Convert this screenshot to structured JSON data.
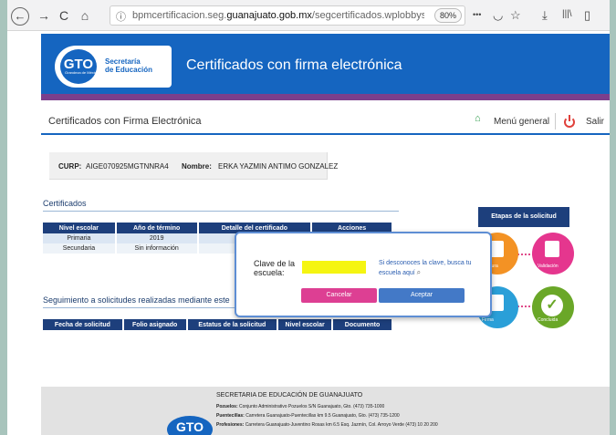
{
  "browser": {
    "back_icon": "←",
    "forward_icon": "→",
    "reload_icon": "C",
    "home_icon": "⌂",
    "url_prefix": "bpmcertificacion.seg.",
    "url_domain": "guanajuato.gob.mx",
    "url_suffix": "/segcertificados.wplobbyseg.asp",
    "zoom": "80%",
    "more_icon": "•••",
    "pocket_icon": "◡",
    "bookmark_icon": "☆",
    "download_icon": "⤓",
    "library_icon": "|||\\",
    "sidebar_icon": "▯"
  },
  "header": {
    "logo": "GTO",
    "logo_sub": "Grandeza de México",
    "org_line1": "Secretaría",
    "org_line2": "de Educación",
    "title": "Certificados con firma electrónica"
  },
  "nav": {
    "title": "Certificados con Firma Electrónica",
    "menu": "Menú general",
    "logout": "Salir"
  },
  "student": {
    "curp_label": "CURP:",
    "curp": "AIGE070925MGTNNRA4",
    "name_label": "Nombre:",
    "name": "ERKA YAZMIN ANTIMO GONZALEZ"
  },
  "certificados": {
    "title": "Certificados",
    "columns": [
      "Nivel escolar",
      "Año de término",
      "Detalle del certificado",
      "Acciones"
    ],
    "rows": [
      [
        "Primaria",
        "2019",
        "",
        ""
      ],
      [
        "Secundaria",
        "Sin información",
        "",
        ""
      ]
    ]
  },
  "seguimiento": {
    "title": "Seguimiento a solicitudes realizadas mediante este",
    "columns": [
      "Fecha de solicitud",
      "Folio asignado",
      "Estatus de la solicitud",
      "Nivel escolar",
      "Documento"
    ]
  },
  "steps": {
    "title": "Etapas de la solicitud",
    "labels": [
      "Captura",
      "Validación",
      "Firma",
      "Concluida"
    ]
  },
  "modal": {
    "label": "Clave de la escuela:",
    "hint": "Si desconoces la clave, busca tu escuela aquí",
    "cancel": "Cancelar",
    "accept": "Aceptar"
  },
  "footer": {
    "title": "SECRETARIA DE EDUCACIÓN DE GUANAJUATO",
    "lines": [
      {
        "label": "Pozuelos:",
        "text": "Conjunto Administrativo Pozuelos S/N Guanajuato, Gto. (473) 735-1000"
      },
      {
        "label": "Puentecillas:",
        "text": "Carretera Guanajuato-Puentecillas km 9.5 Guanajuato, Gto. (473) 735-1200"
      },
      {
        "label": "Profesiones:",
        "text": "Carretera Guanajuato-Juventino Rosas km 6.5 Esq. Jazmín, Col. Arroyo Verde (473) 10 20 200"
      }
    ],
    "logo": "GTO"
  },
  "colors": {
    "brand_blue": "#1565c0",
    "navy": "#1d3f7c",
    "pink": "#dd3f93",
    "accept": "#4379c7",
    "step_orange": "#f39224",
    "step_magenta": "#e5368e",
    "step_blue": "#2a9fd8",
    "step_green": "#6aa728"
  }
}
